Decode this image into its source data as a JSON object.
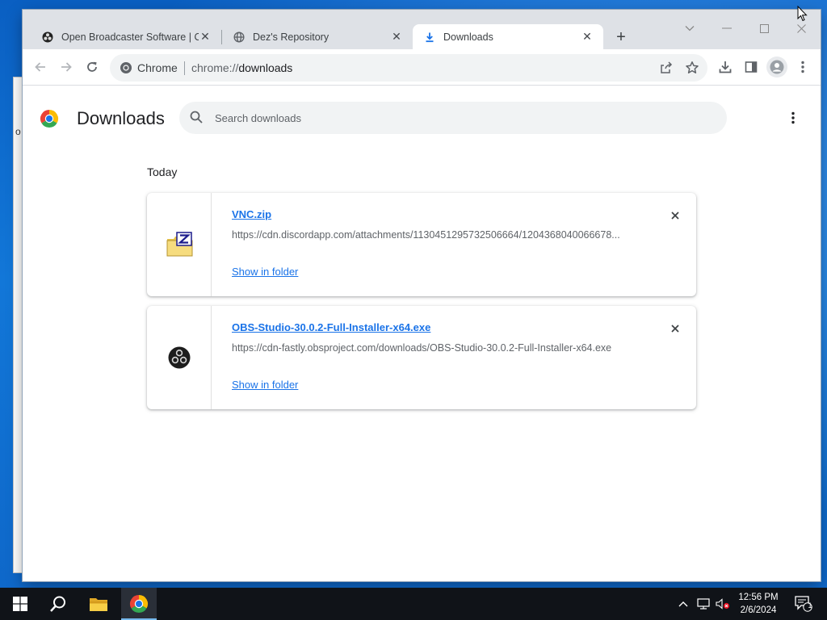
{
  "desktop": {
    "bg_fragments": [
      "o"
    ]
  },
  "browser": {
    "tabs": [
      {
        "label": "Open Broadcaster Software | OBS",
        "favicon": "obs-icon",
        "active": false
      },
      {
        "label": "Dez's Repository",
        "favicon": "globe-icon",
        "active": false
      },
      {
        "label": "Downloads",
        "favicon": "download-icon",
        "active": true
      }
    ],
    "toolbar": {
      "site_chip": "Chrome",
      "url_scheme": "chrome://",
      "url_path": "downloads"
    }
  },
  "downloads_page": {
    "title": "Downloads",
    "search_placeholder": "Search downloads",
    "section_heading": "Today",
    "items": [
      {
        "file_name": "VNC.zip",
        "url": "https://cdn.discordapp.com/attachments/1130451295732506664/1204368040066678...",
        "action": "Show in folder",
        "icon": "zip-folder-icon"
      },
      {
        "file_name": "OBS-Studio-30.0.2-Full-Installer-x64.exe",
        "url": "https://cdn-fastly.obsproject.com/downloads/OBS-Studio-30.0.2-Full-Installer-x64.exe",
        "action": "Show in folder",
        "icon": "obs-icon"
      }
    ]
  },
  "taskbar": {
    "time": "12:56 PM",
    "date": "2/6/2024",
    "notification_count": "1"
  },
  "colors": {
    "link": "#1a73e8",
    "tab_strip": "#dee1e6",
    "omnibox": "#f1f3f4",
    "taskbar": "#101318"
  }
}
